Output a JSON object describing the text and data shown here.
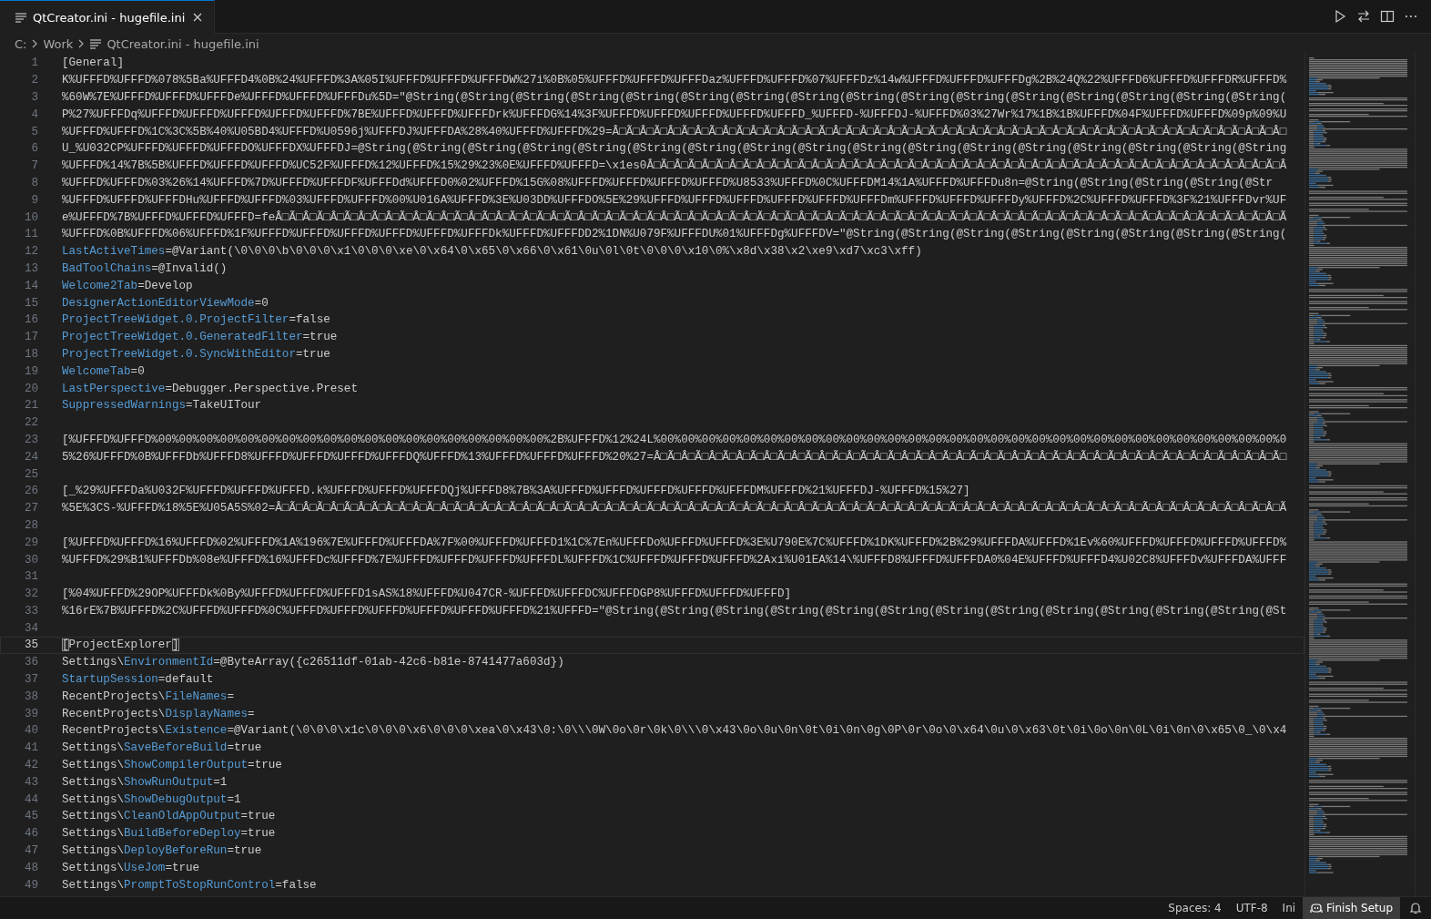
{
  "tab": {
    "title": "QtCreator.ini - hugefile.ini",
    "selected": true
  },
  "breadcrumb": [
    {
      "label": "C:",
      "kind": "folder"
    },
    {
      "label": "Work",
      "kind": "folder"
    },
    {
      "label": "QtCreator.ini - hugefile.ini",
      "kind": "file"
    }
  ],
  "editor": {
    "lines": [
      {
        "number": "1",
        "current": false,
        "parts": [
          {
            "text": "[General]",
            "kind": "plain"
          }
        ]
      },
      {
        "number": "2",
        "current": false,
        "parts": [
          {
            "text": "K%UFFFD%UFFFD%078%5Ba%UFFFD4%0B%24%UFFFD%3A%05I%UFFFD%UFFFD%UFFFDW%27i%0B%05%UFFFD%UFFFD%UFFFDaz%UFFFD%UFFFD%07%UFFFDz%14w%UFFFD%UFFFD%UFFFDg%2B%24Q%22%UFFFD6%UFFFD%UFFFDR%UFFFD%",
            "kind": "plain"
          }
        ]
      },
      {
        "number": "3",
        "current": false,
        "parts": [
          {
            "text": "%60W%7E%UFFFD%UFFFD%UFFFDe%UFFFD%UFFFD%UFFFDu%5D=\"@String(@String(@String(@String(@String(@String(@String(@String(@String(@String(@String(@String(@String(@String(@String(@String(",
            "kind": "plain"
          }
        ]
      },
      {
        "number": "4",
        "current": false,
        "parts": [
          {
            "text": "P%27%UFFFDq%UFFFD%UFFFD%UFFFD%UFFFD%UFFFD%7BE%UFFFD%UFFFD%UFFFDrk%UFFFDG%14%3F%UFFFD%UFFFD%UFFFD%UFFFD%UFFFD_%UFFFD-%UFFFDJ-%UFFFD%03%27Wr%17%1B%1B%UFFFD%04F%UFFFD%UFFFD%09p%09%U",
            "kind": "plain"
          }
        ]
      },
      {
        "number": "5",
        "current": false,
        "parts": [
          {
            "text": "%UFFFD%UFFFD%1C%3C%5B%40%U05BD4%UFFFD%U0596j%UFFFDJ%UFFFDA%28%40%UFFFD%UFFFD%29=Â□Ã□Â□Ã□Â□Ã□Â□Ã□Â□Ã□Â□Ã□Â□Ã□Â□Ã□Â□Ã□Â□Ã□Â□Ã□Â□Ã□Â□Ã□Â□Ã□Â□Ã□Â□Ã□Â□Ã□Â□Ã□Â□Ã□Â□Ã□Â□Ã□Â□Ã□Â□Ã□Â□Ã□Â□",
            "kind": "plain"
          }
        ]
      },
      {
        "number": "6",
        "current": false,
        "parts": [
          {
            "text": "U_%U032CP%UFFFD%UFFFD%UFFFDO%UFFFDX%UFFFDJ=@String(@String(@String(@String(@String(@String(@String(@String(@String(@String(@String(@String(@String(@String(@String(@String(@String",
            "kind": "plain"
          }
        ]
      },
      {
        "number": "7",
        "current": false,
        "parts": [
          {
            "text": "%UFFFD%14%7B%5B%UFFFD%UFFFD%UFFFD%UC52F%UFFFD%12%UFFFD%15%29%23%0E%UFFFD%UFFFD=\\x1es0Â□Ã□Â□Ã□Â□Ã□Â□Ã□Â□Ã□Â□Ã□Â□Ã□Â□Ã□Â□Ã□Â□Ã□Â□Ã□Â□Ã□Â□Ã□Â□Ã□Â□Ã□Â□Ã□Â□Ã□Â□Ã□Â□Ã□Â□Ã□Â□Ã□Â□Ã□Â□Ã□Â",
            "kind": "plain"
          }
        ]
      },
      {
        "number": "8",
        "current": false,
        "parts": [
          {
            "text": "%UFFFD%UFFFD%03%26%14%UFFFD%7D%UFFFD%UFFFDF%UFFFDd%UFFFD0%02%UFFFD%15G%08%UFFFD%UFFFD%UFFFD%UFFFD%U8533%UFFFD%0C%UFFFDM14%1A%UFFFD%UFFFDu8n=@String(@String(@String(@String(@Str",
            "kind": "plain"
          }
        ]
      },
      {
        "number": "9",
        "current": false,
        "parts": [
          {
            "text": "%UFFFD%UFFFD%UFFFDHu%UFFFD%UFFFD%03%UFFFD%UFFFD%00%U016A%UFFFD%3E%U03DD%UFFFDO%5E%29%UFFFD%UFFFD%UFFFD%UFFFD%UFFFD%UFFFDm%UFFFD%UFFFD%UFFFDy%UFFFD%2C%UFFFD%UFFFD%3F%21%UFFFDvr%UF",
            "kind": "plain"
          }
        ]
      },
      {
        "number": "10",
        "current": false,
        "parts": [
          {
            "text": "e%UFFFD%7B%UFFFD%UFFFD%UFFFD=feÂ□Ã□Â□Ã□Â□Ã□Â□Ã□Â□Ã□Â□Ã□Â□Ã□Â□Ã□Â□Ã□Â□Ã□Â□Ã□Â□Ã□Â□Ã□Â□Ã□Â□Ã□Â□Ã□Â□Ã□Â□Ã□Â□Ã□Â□Ã□Â□Ã□Â□Ã□Â□Ã□Â□Ã□Â□Ã□Â□Ã□Â□Ã□Â□Ã□Â□Ã□Â□Ã□Â□Ã□Â□Ã□Â□Ã□Â□Ã□Â□Ã□Â□Ã□Â□Ã",
            "kind": "plain"
          }
        ]
      },
      {
        "number": "11",
        "current": false,
        "parts": [
          {
            "text": "%UFFFD%0B%UFFFD%06%UFFFD%1F%UFFFD%UFFFD%UFFFD%UFFFD%UFFFD%UFFFDk%UFFFD%UFFFDD2%1DN%U079F%UFFFDU%01%UFFFDg%UFFFDV=\"@String(@String(@String(@String(@String(@String(@String(@String(",
            "kind": "plain"
          }
        ]
      },
      {
        "number": "12",
        "current": false,
        "parts": [
          {
            "text": "LastActiveTimes",
            "kind": "key"
          },
          {
            "text": "=@Variant(\\0\\0\\0\\b\\0\\0\\0\\x1\\0\\0\\0\\xe\\0\\x64\\0\\x65\\0\\x66\\0\\x61\\0u\\0l\\0t\\0\\0\\0\\x10\\0%\\x8d\\x38\\x2\\xe9\\xd7\\xc3\\xff)",
            "kind": "plain"
          }
        ]
      },
      {
        "number": "13",
        "current": false,
        "parts": [
          {
            "text": "BadToolChains",
            "kind": "key"
          },
          {
            "text": "=@Invalid()",
            "kind": "plain"
          }
        ]
      },
      {
        "number": "14",
        "current": false,
        "parts": [
          {
            "text": "Welcome2Tab",
            "kind": "key"
          },
          {
            "text": "=Develop",
            "kind": "plain"
          }
        ]
      },
      {
        "number": "15",
        "current": false,
        "parts": [
          {
            "text": "DesignerActionEditorViewMode",
            "kind": "key"
          },
          {
            "text": "=0",
            "kind": "plain"
          }
        ]
      },
      {
        "number": "16",
        "current": false,
        "parts": [
          {
            "text": "ProjectTreeWidget.0.ProjectFilter",
            "kind": "key"
          },
          {
            "text": "=false",
            "kind": "plain"
          }
        ]
      },
      {
        "number": "17",
        "current": false,
        "parts": [
          {
            "text": "ProjectTreeWidget.0.GeneratedFilter",
            "kind": "key"
          },
          {
            "text": "=true",
            "kind": "plain"
          }
        ]
      },
      {
        "number": "18",
        "current": false,
        "parts": [
          {
            "text": "ProjectTreeWidget.0.SyncWithEditor",
            "kind": "key"
          },
          {
            "text": "=true",
            "kind": "plain"
          }
        ]
      },
      {
        "number": "19",
        "current": false,
        "parts": [
          {
            "text": "WelcomeTab",
            "kind": "key"
          },
          {
            "text": "=0",
            "kind": "plain"
          }
        ]
      },
      {
        "number": "20",
        "current": false,
        "parts": [
          {
            "text": "LastPerspective",
            "kind": "key"
          },
          {
            "text": "=Debugger.Perspective.Preset",
            "kind": "plain"
          }
        ]
      },
      {
        "number": "21",
        "current": false,
        "parts": [
          {
            "text": "SuppressedWarnings",
            "kind": "key"
          },
          {
            "text": "=TakeUITour",
            "kind": "plain"
          }
        ]
      },
      {
        "number": "22",
        "current": false
      },
      {
        "number": "23",
        "current": false,
        "parts": [
          {
            "text": "[%UFFFD%UFFFD%00%00%00%00%00%00%00%00%00%00%00%00%00%00%00%00%00%00%00%2B%UFFFD%12%24L%00%00%00%00%00%00%00%00%00%00%00%00%00%00%00%00%00%00%00%00%00%00%00%00%00%00%00%00%00%00%0",
            "kind": "plain"
          }
        ]
      },
      {
        "number": "24",
        "current": false,
        "parts": [
          {
            "text": "5%26%UFFFD%0B%UFFFDb%UFFFD8%UFFFD%UFFFD%UFFFD%UFFFDQ%UFFFD%13%UFFFD%UFFFD%UFFFD%20%27=Â□Ã□Â□Ã□Â□Ã□Â□Ã□Â□Ã□Â□Ã□Â□Ã□Â□Ã□Â□Ã□Â□Ã□Â□Ã□Â□Ã□Â□Ã□Â□Ã□Â□Ã□Â□Ã□Â□Ã□Â□Ã□Â□Ã□Â□Ã□Â□Ã□Â□Ã□Â□Ã□",
            "kind": "plain"
          }
        ]
      },
      {
        "number": "25",
        "current": false
      },
      {
        "number": "26",
        "current": false,
        "parts": [
          {
            "text": "[_%29%UFFFDa%U032F%UFFFD%UFFFD%UFFFD.k%UFFFD%UFFFD%UFFFDQj%UFFFD8%7B%3A%UFFFD%UFFFD%UFFFD%UFFFD%UFFFDM%UFFFD%21%UFFFDJ-%UFFFD%15%27]",
            "kind": "plain"
          }
        ]
      },
      {
        "number": "27",
        "current": false,
        "parts": [
          {
            "text": "%5E%3CS-%UFFFD%18%5E%U05A5S%02=Â□Ã□Â□Ã□Â□Ã□Â□Ã□Â□Ã□Â□Ã□Â□Ã□Â□Ã□Â□Ã□Â□Ã□Â□Ã□Â□Ã□Â□Ã□Â□Ã□Â□Ã□Â□Ã□Â□Ã□Â□Ã□Â□Ã□Â□Ã□Â□Ã□Â□Ã□Â□Ã□Â□Ã□Â□Ã□Â□Ã□Â□Ã□Â□Ã□Â□Ã□Â□Ã□Â□Ã□Â□Ã□Â□Ã□Â□Ã□Â□Ã□Â□Ã□Â□Ã",
            "kind": "plain"
          }
        ]
      },
      {
        "number": "28",
        "current": false
      },
      {
        "number": "29",
        "current": false,
        "parts": [
          {
            "text": "[%UFFFD%UFFFD%16%UFFFD%02%UFFFD%1A%196%7E%UFFFD%UFFFDA%7F%00%UFFFD%UFFFD1%1C%7En%UFFFDo%UFFFD%UFFFD%3E%U790E%7C%UFFFD%1DK%UFFFD%2B%29%UFFFDA%UFFFD%1Ev%60%UFFFD%UFFFD%UFFFD%UFFFD%",
            "kind": "plain"
          }
        ]
      },
      {
        "number": "30",
        "current": false,
        "parts": [
          {
            "text": "%UFFFD%29%B1%UFFFDb%08e%UFFFD%16%UFFFDc%UFFFD%7E%UFFFD%UFFFD%UFFFD%UFFFDL%UFFFD%1C%UFFFD%UFFFD%UFFFD%2Axi%U01EA%14\\%UFFFD8%UFFFD%UFFFDA0%04E%UFFFD%UFFFD4%U02C8%UFFFDv%UFFFDA%UFFF",
            "kind": "plain"
          }
        ]
      },
      {
        "number": "31",
        "current": false
      },
      {
        "number": "32",
        "current": false,
        "parts": [
          {
            "text": "[%04%UFFFD%29OP%UFFFDk%0By%UFFFD%UFFFD%UFFFD1sAS%18%UFFFD%U047CR-%UFFFD%UFFFDC%UFFFDGP8%UFFFD%UFFFD%UFFFD]",
            "kind": "plain"
          }
        ]
      },
      {
        "number": "33",
        "current": false,
        "parts": [
          {
            "text": "%16rE%7B%UFFFD%2C%UFFFD%UFFFD%0C%UFFFD%UFFFD%UFFFD%UFFFD%UFFFD%UFFFD%21%UFFFD=\"@String(@String(@String(@String(@String(@String(@String(@String(@String(@String(@String(@String(@St",
            "kind": "plain"
          }
        ]
      },
      {
        "number": "34",
        "current": false
      },
      {
        "number": "35",
        "current": true,
        "parts": [
          {
            "text": "[",
            "kind": "bracket"
          },
          {
            "text": "ProjectExplorer",
            "kind": "plain"
          },
          {
            "text": "]",
            "kind": "bracket"
          }
        ]
      },
      {
        "number": "36",
        "current": false,
        "parts": [
          {
            "text": "Settings\\",
            "kind": "plain"
          },
          {
            "text": "EnvironmentId",
            "kind": "key"
          },
          {
            "text": "=@ByteArray({c26511df-01ab-42c6-b81e-8741477a603d})",
            "kind": "plain"
          }
        ]
      },
      {
        "number": "37",
        "current": false,
        "parts": [
          {
            "text": "StartupSession",
            "kind": "key"
          },
          {
            "text": "=default",
            "kind": "plain"
          }
        ]
      },
      {
        "number": "38",
        "current": false,
        "parts": [
          {
            "text": "RecentProjects\\",
            "kind": "plain"
          },
          {
            "text": "FileNames",
            "kind": "key"
          },
          {
            "text": "=",
            "kind": "plain"
          }
        ]
      },
      {
        "number": "39",
        "current": false,
        "parts": [
          {
            "text": "RecentProjects\\",
            "kind": "plain"
          },
          {
            "text": "DisplayNames",
            "kind": "key"
          },
          {
            "text": "=",
            "kind": "plain"
          }
        ]
      },
      {
        "number": "40",
        "current": false,
        "parts": [
          {
            "text": "RecentProjects\\",
            "kind": "plain"
          },
          {
            "text": "Existence",
            "kind": "key"
          },
          {
            "text": "=@Variant(\\0\\0\\0\\x1c\\0\\0\\0\\x6\\0\\0\\0\\xea\\0\\x43\\0:\\0\\\\\\0W\\0o\\0r\\0k\\0\\\\\\0\\x43\\0o\\0u\\0n\\0t\\0i\\0n\\0g\\0P\\0r\\0o\\0\\x64\\0u\\0\\x63\\0t\\0i\\0o\\0n\\0L\\0i\\0n\\0\\x65\\0_\\0\\x4",
            "kind": "plain"
          }
        ]
      },
      {
        "number": "41",
        "current": false,
        "parts": [
          {
            "text": "Settings\\",
            "kind": "plain"
          },
          {
            "text": "SaveBeforeBuild",
            "kind": "key"
          },
          {
            "text": "=true",
            "kind": "plain"
          }
        ]
      },
      {
        "number": "42",
        "current": false,
        "parts": [
          {
            "text": "Settings\\",
            "kind": "plain"
          },
          {
            "text": "ShowCompilerOutput",
            "kind": "key"
          },
          {
            "text": "=true",
            "kind": "plain"
          }
        ]
      },
      {
        "number": "43",
        "current": false,
        "parts": [
          {
            "text": "Settings\\",
            "kind": "plain"
          },
          {
            "text": "ShowRunOutput",
            "kind": "key"
          },
          {
            "text": "=1",
            "kind": "plain"
          }
        ]
      },
      {
        "number": "44",
        "current": false,
        "parts": [
          {
            "text": "Settings\\",
            "kind": "plain"
          },
          {
            "text": "ShowDebugOutput",
            "kind": "key"
          },
          {
            "text": "=1",
            "kind": "plain"
          }
        ]
      },
      {
        "number": "45",
        "current": false,
        "parts": [
          {
            "text": "Settings\\",
            "kind": "plain"
          },
          {
            "text": "CleanOldAppOutput",
            "kind": "key"
          },
          {
            "text": "=true",
            "kind": "plain"
          }
        ]
      },
      {
        "number": "46",
        "current": false,
        "parts": [
          {
            "text": "Settings\\",
            "kind": "plain"
          },
          {
            "text": "BuildBeforeDeploy",
            "kind": "key"
          },
          {
            "text": "=true",
            "kind": "plain"
          }
        ]
      },
      {
        "number": "47",
        "current": false,
        "parts": [
          {
            "text": "Settings\\",
            "kind": "plain"
          },
          {
            "text": "DeployBeforeRun",
            "kind": "key"
          },
          {
            "text": "=true",
            "kind": "plain"
          }
        ]
      },
      {
        "number": "48",
        "current": false,
        "parts": [
          {
            "text": "Settings\\",
            "kind": "plain"
          },
          {
            "text": "UseJom",
            "kind": "key"
          },
          {
            "text": "=true",
            "kind": "plain"
          }
        ]
      },
      {
        "number": "49",
        "current": false,
        "parts": [
          {
            "text": "Settings\\",
            "kind": "plain"
          },
          {
            "text": "PromptToStopRunControl",
            "kind": "key"
          },
          {
            "text": "=false",
            "kind": "plain"
          }
        ]
      }
    ]
  },
  "status_bar": {
    "items": [
      {
        "label": "Spaces: 4",
        "kind": "text"
      },
      {
        "label": "UTF-8",
        "kind": "text"
      },
      {
        "label": "Ini",
        "kind": "text"
      },
      {
        "label": "Finish Setup",
        "kind": "setup"
      }
    ]
  }
}
